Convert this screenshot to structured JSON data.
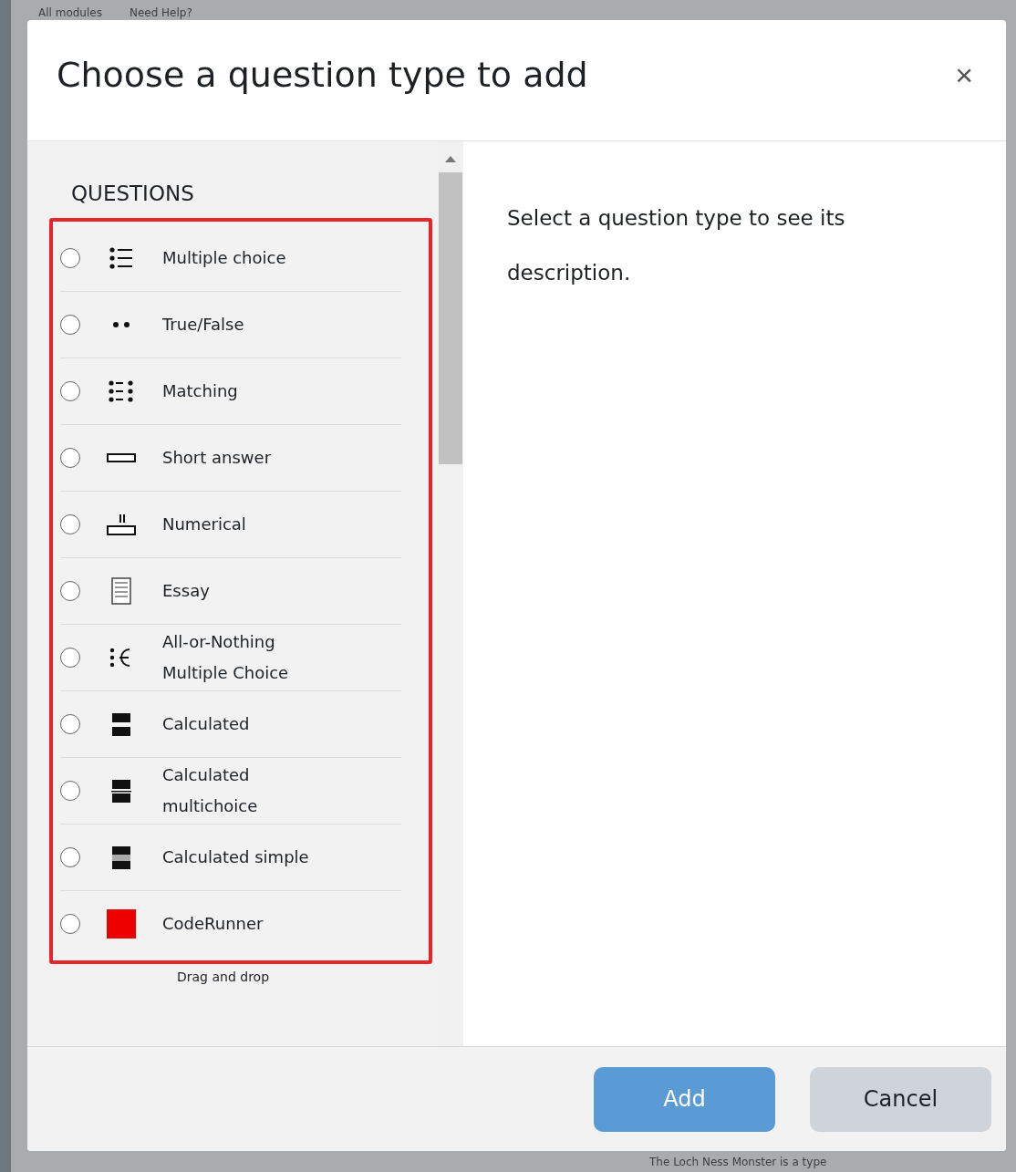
{
  "backdrop": {
    "top_links": [
      "All modules",
      "Need Help?"
    ],
    "bottom_text": "The Loch Ness Monster is a type"
  },
  "dialog": {
    "title": "Choose a question type to add",
    "close": "×",
    "section_heading": "QUESTIONS",
    "options": [
      {
        "label": "Multiple choice",
        "selected": false
      },
      {
        "label": "True/False",
        "selected": false
      },
      {
        "label": "Matching",
        "selected": false
      },
      {
        "label": "Short answer",
        "selected": false
      },
      {
        "label": "Numerical",
        "selected": false
      },
      {
        "label": "Essay",
        "selected": false
      },
      {
        "label": "All-or-Nothing Multiple Choice",
        "selected": false
      },
      {
        "label": "Calculated",
        "selected": false
      },
      {
        "label": "Calculated multichoice",
        "selected": false
      },
      {
        "label": "Calculated simple",
        "selected": false
      },
      {
        "label": "CodeRunner",
        "selected": false
      }
    ],
    "next_option": "Drag and drop",
    "description": "Select a question type to see its description.",
    "buttons": [
      {
        "label": "Add",
        "kind": "primary"
      },
      {
        "label": "Cancel",
        "kind": "secondary"
      }
    ]
  }
}
